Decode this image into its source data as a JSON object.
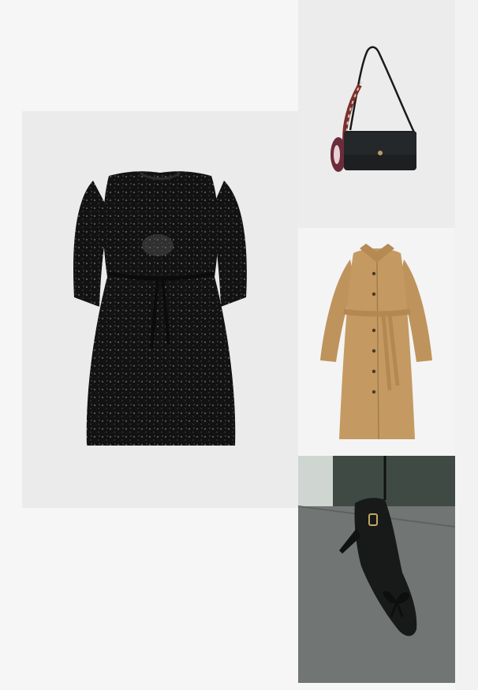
{
  "board": {
    "items": [
      {
        "name": "dress",
        "kind": "sequin mini dress",
        "color": "#141414"
      },
      {
        "name": "bag",
        "kind": "shoulder bag with scarf handle",
        "color": "#1d1f21"
      },
      {
        "name": "coat",
        "kind": "trench coat",
        "color": "#c49a62"
      },
      {
        "name": "shoe",
        "kind": "slingback pump with bow",
        "color": "#171a18"
      }
    ],
    "background_color": "#f6f6f6"
  }
}
